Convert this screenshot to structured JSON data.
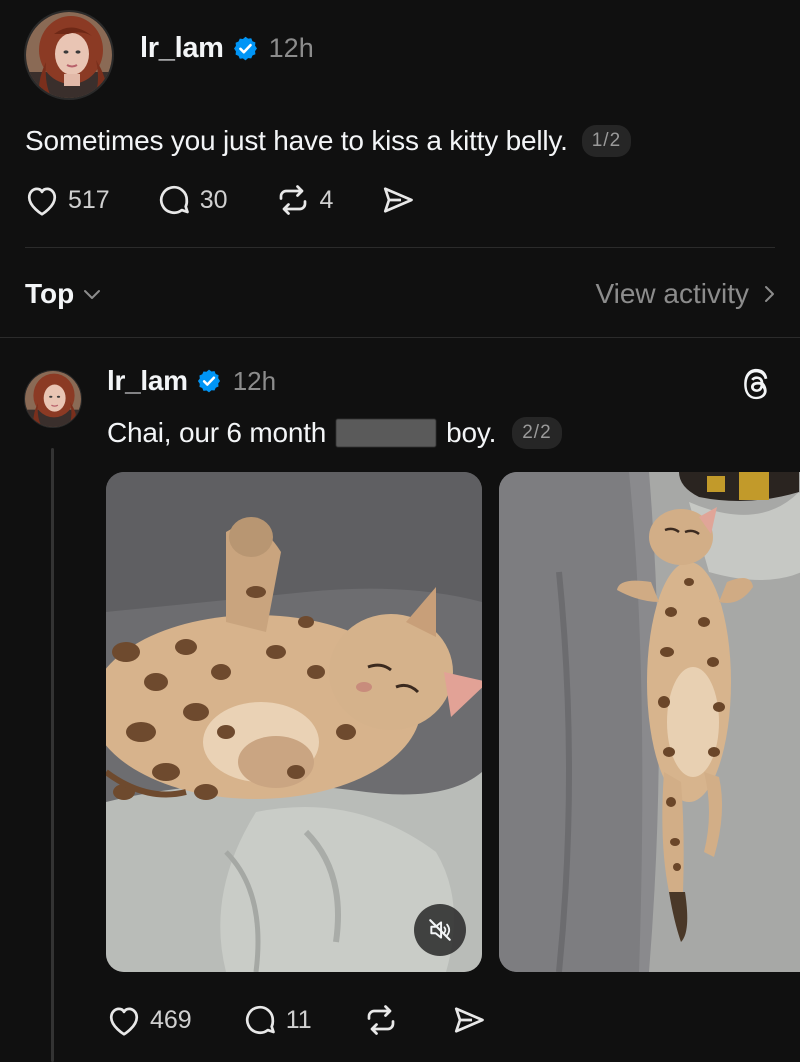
{
  "main_post": {
    "username": "lr_lam",
    "time": "12h",
    "text": "Sometimes you just have to kiss a kitty belly.",
    "page_indicator": "1/2",
    "likes": "517",
    "replies": "30",
    "reposts": "4"
  },
  "sort": {
    "label": "Top",
    "view_activity": "View activity"
  },
  "reply_post": {
    "username": "lr_lam",
    "time": "12h",
    "text_before": "Chai, our 6 month",
    "text_after": "boy.",
    "page_indicator": "2/2",
    "likes": "469",
    "replies": "11"
  },
  "icons": {
    "verified": "verified-badge-icon",
    "like": "heart-icon",
    "reply": "comment-icon",
    "repost": "repost-icon",
    "share": "send-icon",
    "sort": "chevron-down-icon",
    "view": "chevron-right-icon",
    "threads": "threads-logo-icon",
    "mute": "muted-speaker-icon"
  },
  "colors": {
    "background": "#101010",
    "verified": "#0095f6",
    "text": "#f3f5f7",
    "secondary": "#8c8c8c"
  }
}
